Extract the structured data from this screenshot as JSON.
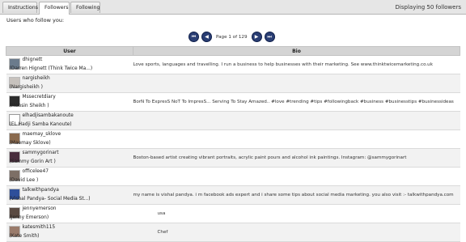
{
  "tabs": [
    {
      "label": "Instructions"
    },
    {
      "label": "Followers",
      "active": true
    },
    {
      "label": "Following"
    }
  ],
  "status_text": "Displaying 50 followers",
  "intro_text": "Users who follow you:",
  "pagination": {
    "label": "Page 1 of 129",
    "first_glyph": "⏮",
    "prev_glyph": "◀",
    "next_glyph": "▶",
    "last_glyph": "⏭"
  },
  "table": {
    "headers": {
      "user": "User",
      "bio": "Bio"
    },
    "rows": [
      {
        "username": "dhignett",
        "display_name": "(Darren Hignett (Think Twice Ma...)",
        "bio": "Love sports, languages and travelling. I run a business to help businesses with their marketing. See www.thinktwicemarketing.co.uk",
        "avatar_color": "#6b7b8c"
      },
      {
        "username": "nargisheikh",
        "display_name": "(Nargisheikh )",
        "bio": "",
        "avatar_color": "#c7c2bd"
      },
      {
        "username": "Mssecretdiary",
        "display_name": "(Mohsin Sheikh )",
        "bio": "BorN To ExpresS NoT To ImpresS... Serving To Stay Amazed.. #love #trending #tips #followingback #business #businesstips #businessideas",
        "avatar_color": "#2b2b2b"
      },
      {
        "username": "elhadjisambakanoute",
        "display_name": "(EL Hadji Samba Kanoute)",
        "bio": "",
        "avatar_color": "#ffffff",
        "empty_avatar": true
      },
      {
        "username": "maemay_sklove",
        "display_name": "(Maemay Sklove)",
        "bio": "",
        "avatar_color": "#8a6a4e"
      },
      {
        "username": "sammygorinart",
        "display_name": "(Sammy Gorin Art )",
        "bio": "Boston-based artist creating vibrant portraits, acrylic paint pours and alcohol ink paintings. Instagram: @sammygorinart",
        "avatar_color": "#4a2e3e"
      },
      {
        "username": "officelee47",
        "display_name": "(David Lee )",
        "bio": "",
        "avatar_color": "#7d6f66"
      },
      {
        "username": "talkwithpandya",
        "display_name": "(Vishal Pandya- Social Media St...)",
        "bio": "my name is vishal pandya. i m facebook ads expert and i share some tips about social media marketing. you also visit :- talkwithpandya.com",
        "avatar_color": "#2e4f9a"
      },
      {
        "username": "jennyemerson",
        "display_name": "(Jenny Emerson)",
        "bio": "usa",
        "avatar_color": "#5a4a42",
        "bio_indent": true
      },
      {
        "username": "katesmith115",
        "display_name": "(Kate Smith)",
        "bio": "Chef",
        "avatar_color": "#9a7b6b",
        "bio_indent": true
      }
    ]
  }
}
